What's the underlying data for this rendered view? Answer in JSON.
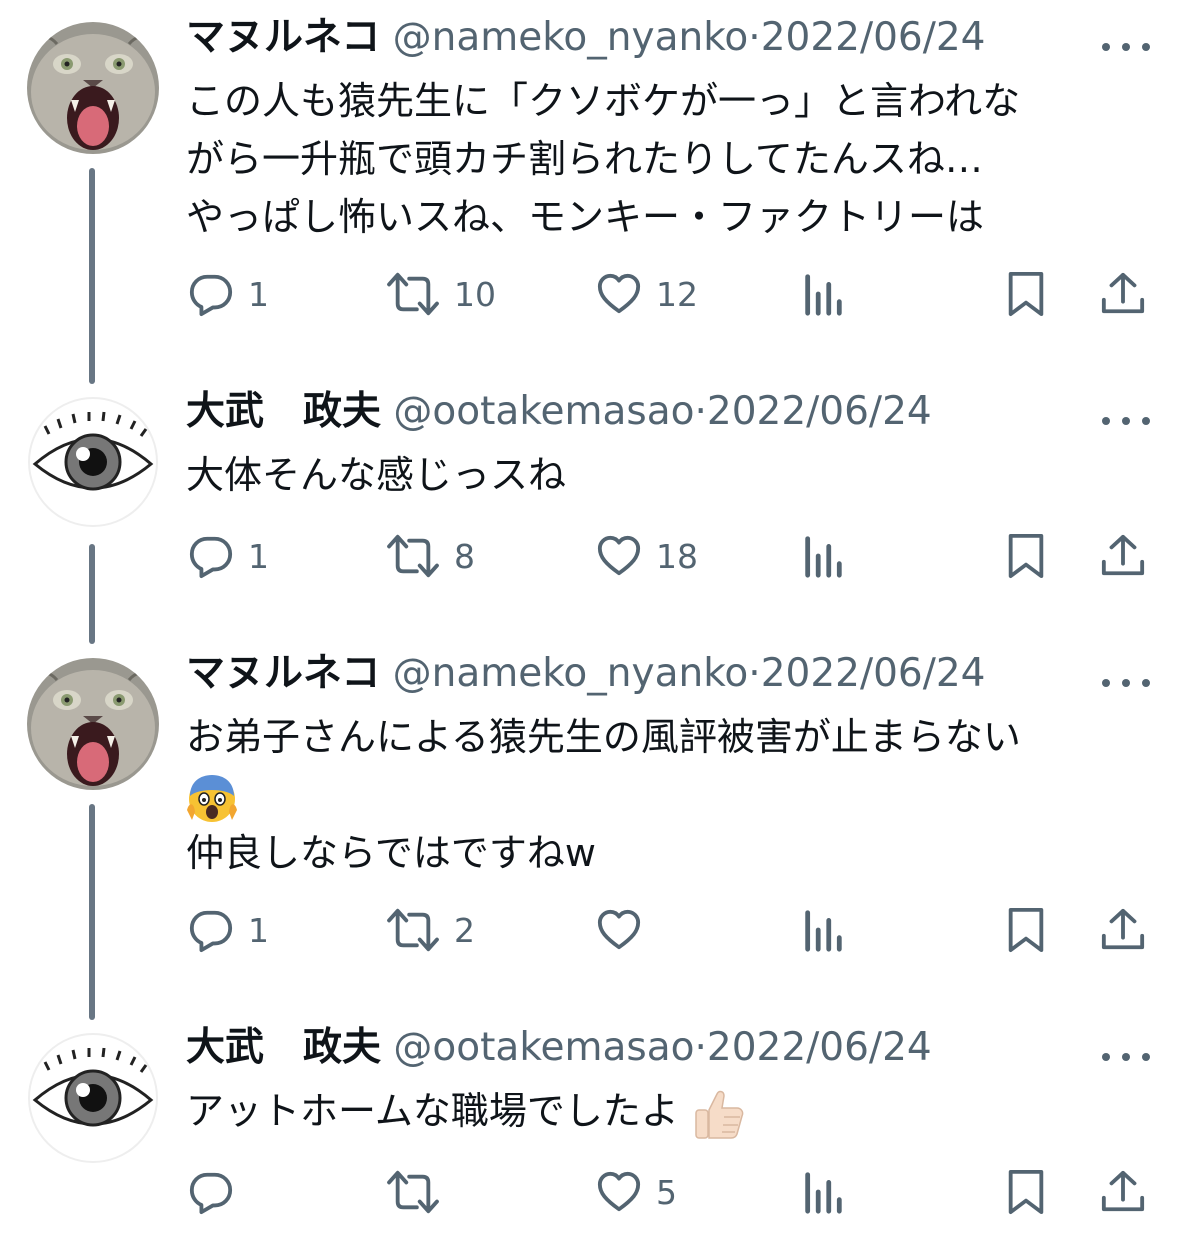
{
  "tweets": [
    {
      "name": "マヌルネコ",
      "handle": "@nameko_nyanko",
      "sep": "·",
      "date": "2022/06/24",
      "lines": [
        "この人も猿先生に「クソボケが一っ」と言われな",
        "がら一升瓶で頭カチ割られたりしてたんスね…",
        "やっぱし怖いスね、モンキー・ファクトリーは"
      ],
      "replies": "1",
      "retweets": "10",
      "likes": "12"
    },
    {
      "name": "大武　政夫",
      "handle": "@ootakemasao",
      "sep": "·",
      "date": "2022/06/24",
      "lines": [
        "大体そんな感じっスね"
      ],
      "replies": "1",
      "retweets": "8",
      "likes": "18"
    },
    {
      "name": "マヌルネコ",
      "handle": "@nameko_nyanko",
      "sep": "·",
      "date": "2022/06/24",
      "lines": [
        "お弟子さんによる猿先生の風評被害が止まらない",
        "仲良しならではですねw"
      ],
      "emoji": "fearful-face-emoji",
      "replies": "1",
      "retweets": "2",
      "likes": ""
    },
    {
      "name": "大武　政夫",
      "handle": "@ootakemasao",
      "sep": "·",
      "date": "2022/06/24",
      "lines": [
        "アットホームな職場でしたよ"
      ],
      "emoji": "thumbs-up-emoji",
      "replies": "",
      "retweets": "",
      "likes": "5"
    }
  ],
  "icons": {
    "reply": "reply-icon",
    "retweet": "retweet-icon",
    "like": "heart-icon",
    "views": "views-bar-chart-icon",
    "bookmark": "bookmark-icon",
    "share": "share-icon",
    "more": "more-dots-icon"
  },
  "colors": {
    "text": "#0f1419",
    "secondary": "#536471",
    "thread": "#687684"
  }
}
